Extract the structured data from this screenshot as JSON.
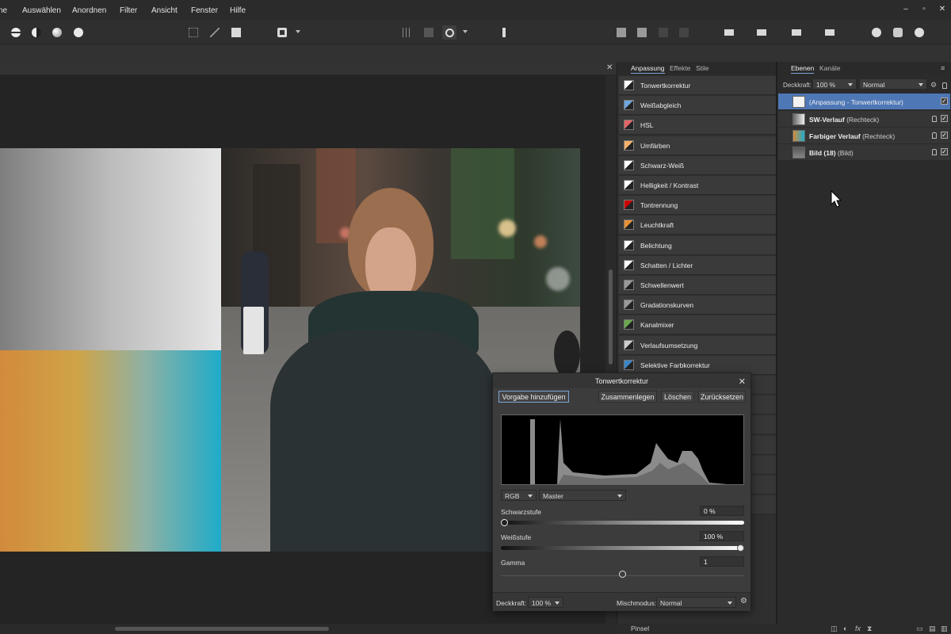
{
  "menu": {
    "items": [
      "ne",
      "Auswählen",
      "Anordnen",
      "Filter",
      "Ansicht",
      "Fenster",
      "Hilfe"
    ],
    "window_controls": [
      "–",
      "▫",
      "✕"
    ]
  },
  "adjust_panel": {
    "tabs": [
      "Anpassung",
      "Effekte",
      "Stile"
    ],
    "items": [
      {
        "label": "Tonwertkorrektur",
        "icon": "levels-icon",
        "color": "#ffffff"
      },
      {
        "label": "Weißabgleich",
        "icon": "white-balance-icon",
        "color": "#6fa8dc"
      },
      {
        "label": "HSL",
        "icon": "hsl-icon",
        "color": "#e06666"
      },
      {
        "label": "Umfärben",
        "icon": "recolor-icon",
        "color": "#f6b26b"
      },
      {
        "label": "Schwarz-Weiß",
        "icon": "black-white-icon",
        "color": "#ffffff"
      },
      {
        "label": "Helligkeit / Kontrast",
        "icon": "brightness-contrast-icon",
        "color": "#ffffff"
      },
      {
        "label": "Tontrennung",
        "icon": "posterize-icon",
        "color": "#cc0000"
      },
      {
        "label": "Leuchtkraft",
        "icon": "vibrance-icon",
        "color": "#e69138"
      },
      {
        "label": "Belichtung",
        "icon": "exposure-icon",
        "color": "#ffffff"
      },
      {
        "label": "Schatten / Lichter",
        "icon": "shadows-highlights-icon",
        "color": "#ffffff"
      },
      {
        "label": "Schwellenwert",
        "icon": "threshold-icon",
        "color": "#999999"
      },
      {
        "label": "Gradationskurven",
        "icon": "curves-icon",
        "color": "#999999"
      },
      {
        "label": "Kanalmixer",
        "icon": "channel-mixer-icon",
        "color": "#6aa84f"
      },
      {
        "label": "Verlaufsumsetzung",
        "icon": "gradient-map-icon",
        "color": "#cccccc"
      },
      {
        "label": "Selektive Farbkorrektur",
        "icon": "selective-color-icon",
        "color": "#3d85c6"
      }
    ]
  },
  "layers_panel": {
    "tabs": [
      "Ebenen",
      "Kanäle"
    ],
    "opacity_label": "Deckkraft:",
    "opacity_value": "100 %",
    "blend_mode": "Normal",
    "layers": [
      {
        "name": "(Anpassung - Tonwertkorrektur)",
        "type": "",
        "selected": true
      },
      {
        "name": "SW-Verlauf",
        "type": "(Rechteck)",
        "selected": false
      },
      {
        "name": "Farbiger Verlauf",
        "type": "(Rechteck)",
        "selected": false
      },
      {
        "name": "Bild (18)",
        "type": "(Bild)",
        "selected": false
      }
    ]
  },
  "dialog": {
    "title": "Tonwertkorrektur",
    "buttons": {
      "add_preset": "Vorgabe hinzufügen",
      "merge": "Zusammenlegen",
      "delete": "Löschen",
      "reset": "Zurücksetzen"
    },
    "channel": "RGB",
    "channel_mode": "Master",
    "black_label": "Schwarzstufe",
    "black_value": "0 %",
    "white_label": "Weißstufe",
    "white_value": "100 %",
    "gamma_label": "Gamma",
    "gamma_value": "1",
    "opacity_label": "Deckkraft:",
    "opacity_value": "100 %",
    "blend_label": "Mischmodus:",
    "blend_value": "Normal"
  },
  "status": {
    "tool": "Pinsel"
  }
}
